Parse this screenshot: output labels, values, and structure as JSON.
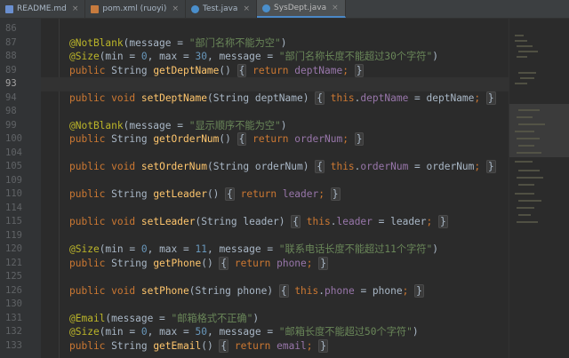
{
  "tabs": [
    {
      "label": "README.md",
      "icon_color": "#6a8fcf",
      "active": false
    },
    {
      "label": "pom.xml (ruoyi)",
      "icon_color": "#c77b3e",
      "active": false
    },
    {
      "label": "Test.java",
      "icon_color": "#4a8fcc",
      "active": false
    },
    {
      "label": "SysDept.java",
      "icon_color": "#4a8fcc",
      "active": true
    }
  ],
  "lines": [
    {
      "n": "87",
      "text": "@NotBlank(message = \"部门名称不能为空\")"
    },
    {
      "n": "88",
      "text": "@Size(min = 0, max = 30, message = \"部门名称长度不能超过30个字符\")"
    },
    {
      "n": "89",
      "text": "public String getDeptName() { return deptName; }"
    },
    {
      "n": "93",
      "text": ""
    },
    {
      "n": "94",
      "text": "public void setDeptName(String deptName) { this.deptName = deptName; }"
    },
    {
      "n": "98",
      "text": ""
    },
    {
      "n": "99",
      "text": "@NotBlank(message = \"显示顺序不能为空\")"
    },
    {
      "n": "100",
      "text": "public String getOrderNum() { return orderNum; }"
    },
    {
      "n": "104",
      "text": ""
    },
    {
      "n": "105",
      "text": "public void setOrderNum(String orderNum) { this.orderNum = orderNum; }"
    },
    {
      "n": "109",
      "text": ""
    },
    {
      "n": "110",
      "text": "public String getLeader() { return leader; }"
    },
    {
      "n": "114",
      "text": ""
    },
    {
      "n": "115",
      "text": "public void setLeader(String leader) { this.leader = leader; }"
    },
    {
      "n": "119",
      "text": ""
    },
    {
      "n": "120",
      "text": "@Size(min = 0, max = 11, message = \"联系电话长度不能超过11个字符\")"
    },
    {
      "n": "121",
      "text": "public String getPhone() { return phone; }"
    },
    {
      "n": "125",
      "text": ""
    },
    {
      "n": "126",
      "text": "public void setPhone(String phone) { this.phone = phone; }"
    },
    {
      "n": "130",
      "text": ""
    },
    {
      "n": "131",
      "text": "@Email(message = \"邮箱格式不正确\")"
    },
    {
      "n": "132",
      "text": "@Size(min = 0, max = 50, message = \"邮箱长度不能超过50个字符\")"
    },
    {
      "n": "133",
      "text": "public String getEmail() { return email; }"
    }
  ],
  "line_86": "86",
  "current_line": "93",
  "minimap_color": "#5a5a4a"
}
